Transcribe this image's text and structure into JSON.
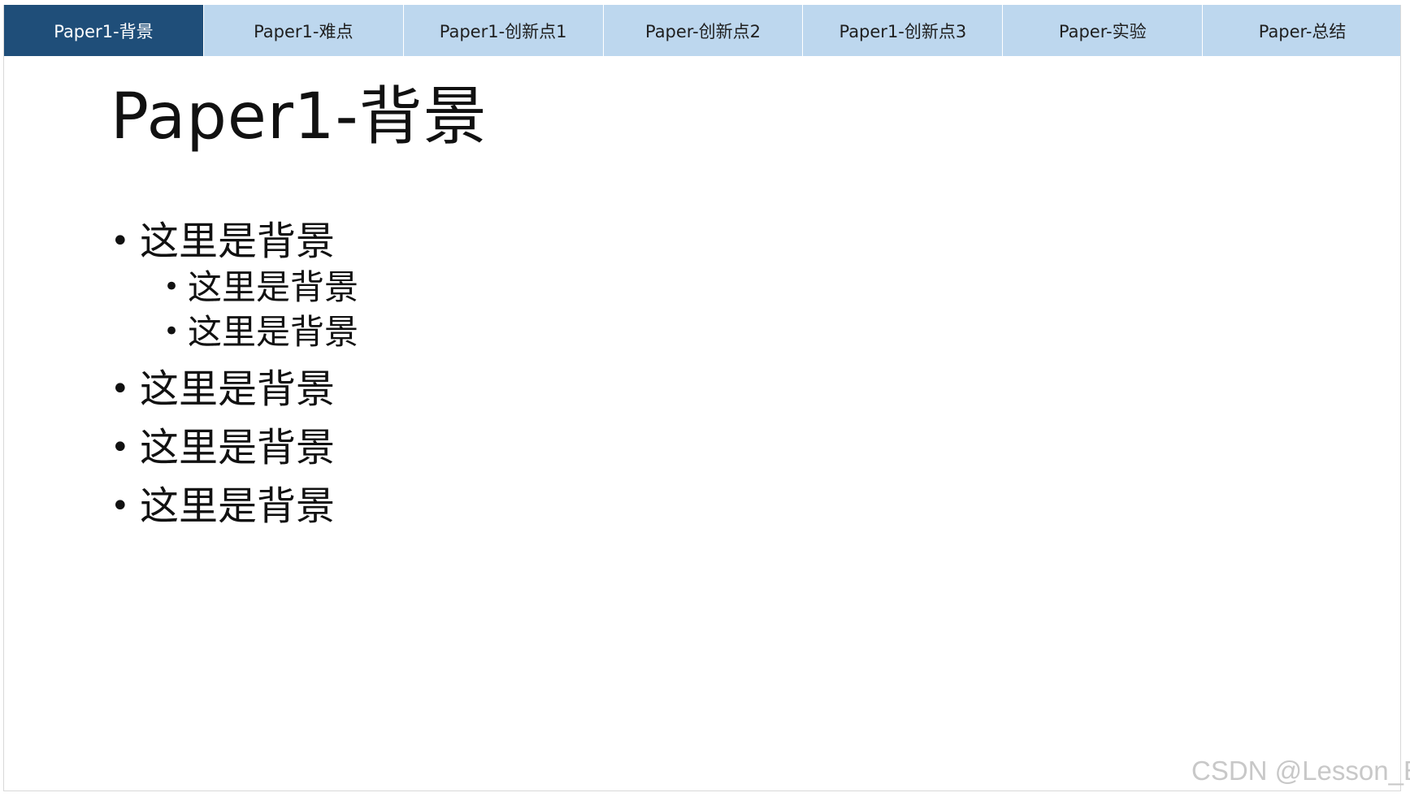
{
  "tabs": [
    {
      "label": "Paper1-背景",
      "active": true
    },
    {
      "label": "Paper1-难点",
      "active": false
    },
    {
      "label": "Paper1-创新点1",
      "active": false
    },
    {
      "label": "Paper-创新点2",
      "active": false
    },
    {
      "label": "Paper1-创新点3",
      "active": false
    },
    {
      "label": "Paper-实验",
      "active": false
    },
    {
      "label": "Paper-总结",
      "active": false
    }
  ],
  "title": "Paper1-背景",
  "bullets": {
    "item1": "这里是背景",
    "item1_sub1": "这里是背景",
    "item1_sub2": "这里是背景",
    "item2": "这里是背景",
    "item3": "这里是背景",
    "item4": "这里是背景"
  },
  "watermark": "CSDN @Lesson_E",
  "colors": {
    "tab_active_bg": "#1f4e79",
    "tab_inactive_bg": "#bdd7ee"
  }
}
